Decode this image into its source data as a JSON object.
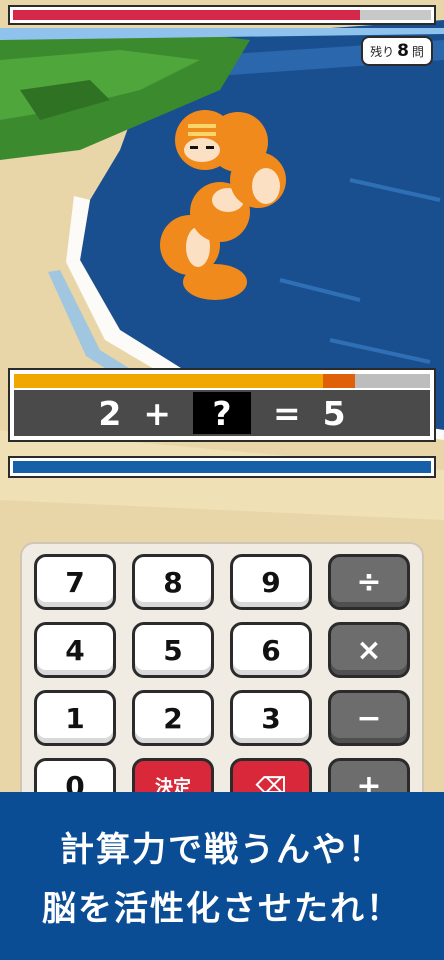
{
  "enemy_hp": {
    "fraction": 0.83
  },
  "remaining": {
    "prefix": "残り",
    "count": "8",
    "suffix": "問"
  },
  "timer": {
    "fraction": 0.82
  },
  "player_hp": {
    "fraction": 1.0
  },
  "equation": {
    "left": "2",
    "op": "+",
    "blank": "?",
    "eq": "=",
    "result": "5"
  },
  "keys": {
    "k7": "7",
    "k8": "8",
    "k9": "9",
    "div": "÷",
    "k4": "4",
    "k5": "5",
    "k6": "6",
    "mul": "×",
    "k1": "1",
    "k2": "2",
    "k3": "3",
    "sub": "−",
    "k0": "0",
    "ok": "決定",
    "del": "⌫",
    "add": "+"
  },
  "banner": {
    "line1": "計算力で戦うんや！",
    "line2": "脳を活性化させたれ！"
  },
  "colors": {
    "sea": "#1a4f8f",
    "sand": "#e9d6a8",
    "grass": "#3b8a2e",
    "enemy": "#f08a1c",
    "accent_red": "#d6284a",
    "banner": "#0b4d95"
  }
}
